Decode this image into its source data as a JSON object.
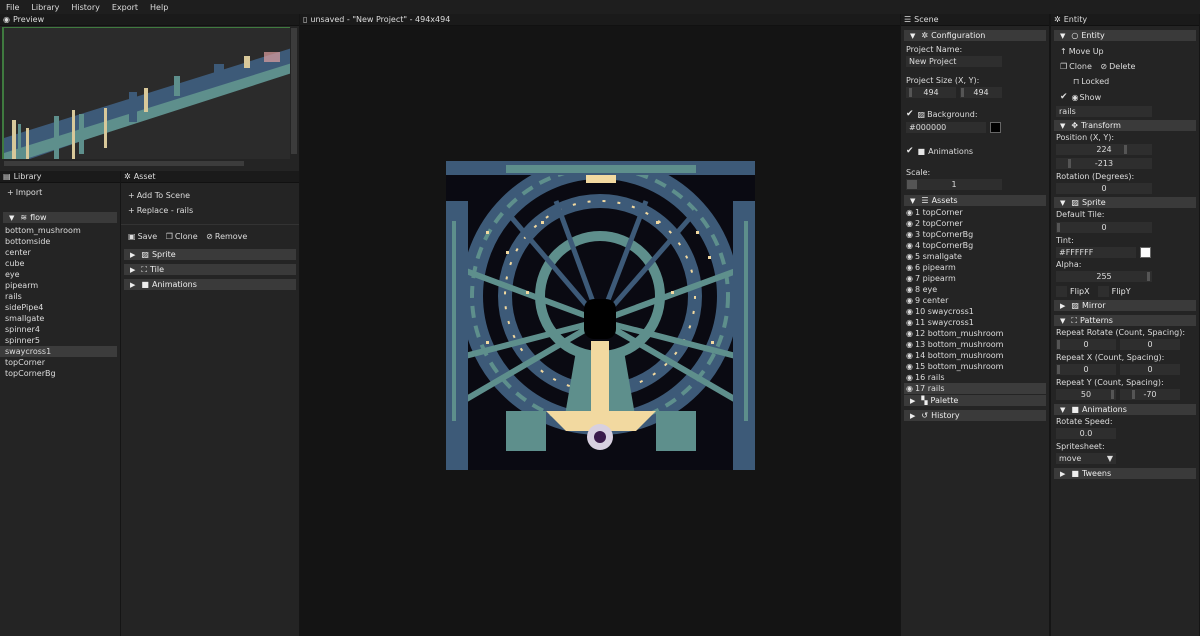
{
  "menu": [
    "File",
    "Library",
    "History",
    "Export",
    "Help"
  ],
  "preview": {
    "title": "Preview"
  },
  "library": {
    "title": "Library",
    "import_label": "Import",
    "group": "flow",
    "items": [
      "bottom_mushroom",
      "bottomside",
      "center",
      "cube",
      "eye",
      "pipearm",
      "rails",
      "sidePipe4",
      "smallgate",
      "spinner4",
      "spinner5",
      "swaycross1",
      "topCorner",
      "topCornerBg"
    ],
    "selected_index": 11
  },
  "asset": {
    "title": "Asset",
    "add_label": "Add To Scene",
    "replace_label": "Replace  - rails",
    "save_label": "Save",
    "clone_label": "Clone",
    "remove_label": "Remove",
    "sections": [
      "Sprite",
      "Tile",
      "Animations"
    ]
  },
  "canvas": {
    "title": "unsaved - \"New Project\" - 494x494"
  },
  "scene": {
    "title": "Scene",
    "configuration": "Configuration",
    "project_name_label": "Project Name:",
    "project_name": "New Project",
    "project_size_label": "Project Size (X, Y):",
    "size_x": "494",
    "size_y": "494",
    "background_label": "Background:",
    "background_value": "#000000",
    "background_color": "#000000",
    "animations_label": "Animations",
    "scale_label": "Scale:",
    "scale_value": "1",
    "assets_label": "Assets",
    "assets": [
      "1 topCorner",
      "2 topCorner",
      "3 topCornerBg",
      "4 topCornerBg",
      "5 smallgate",
      "6 pipearm",
      "7 pipearm",
      "8 eye",
      "9 center",
      "10 swaycross1",
      "11 swaycross1",
      "12 bottom_mushroom",
      "13 bottom_mushroom",
      "14 bottom_mushroom",
      "15 bottom_mushroom",
      "16 rails",
      "17 rails"
    ],
    "selected_asset_index": 16,
    "palette_label": "Palette",
    "history_label": "History"
  },
  "entity": {
    "title": "Entity",
    "section": "Entity",
    "move_up": "Move Up",
    "clone": "Clone",
    "delete": "Delete",
    "locked": "Locked",
    "show": "Show",
    "name": "rails",
    "transform": "Transform",
    "position_label": "Position (X, Y):",
    "pos_x": "224",
    "pos_y": "-213",
    "rotation_label": "Rotation (Degrees):",
    "rotation": "0",
    "sprite": "Sprite",
    "default_tile_label": "Default Tile:",
    "default_tile": "0",
    "tint_label": "Tint:",
    "tint": "#FFFFFF",
    "tint_color": "#FFFFFF",
    "alpha_label": "Alpha:",
    "alpha": "255",
    "flipx": "FlipX",
    "flipy": "FlipY",
    "mirror": "Mirror",
    "patterns": "Patterns",
    "repeat_rotate_label": "Repeat Rotate (Count, Spacing):",
    "rr_count": "0",
    "rr_spacing": "0",
    "repeat_x_label": "Repeat X (Count, Spacing):",
    "rx_count": "0",
    "rx_spacing": "0",
    "repeat_y_label": "Repeat Y (Count, Spacing):",
    "ry_count": "50",
    "ry_spacing": "-70",
    "animations": "Animations",
    "rotate_speed_label": "Rotate Speed:",
    "rotate_speed": "0.0",
    "spritesheet_label": "Spritesheet:",
    "spritesheet": "move",
    "tweens": "Tweens"
  },
  "colors": {
    "teal": "#5e8f8c",
    "blue": "#3d5a78",
    "cream": "#f2d9a0",
    "panel": "#242424",
    "accent": "#3a3a3a"
  }
}
